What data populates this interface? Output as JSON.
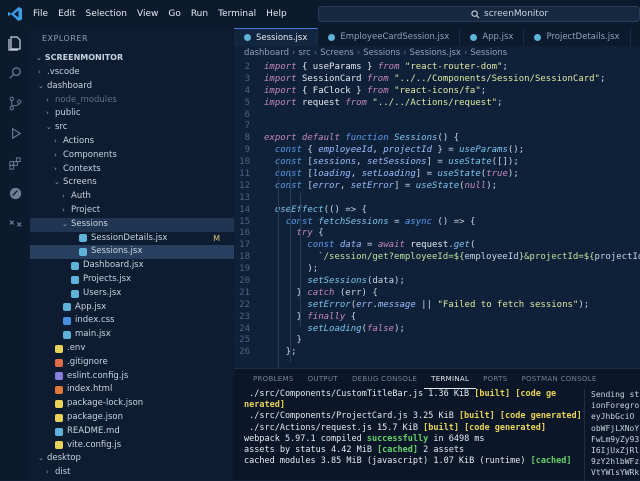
{
  "menu": [
    "File",
    "Edit",
    "Selection",
    "View",
    "Go",
    "Run",
    "Terminal",
    "Help"
  ],
  "command_center": "screenMonitor",
  "explorer": {
    "title": "EXPLORER",
    "root": "SCREENMONITOR",
    "items": [
      {
        "label": ".vscode",
        "indent": 0,
        "type": "folder-closed",
        "color": "#5f7fa8"
      },
      {
        "label": "dashboard",
        "indent": 0,
        "type": "folder-open",
        "color": "#5f7fa8"
      },
      {
        "label": "node_modules",
        "indent": 1,
        "type": "folder-closed",
        "color": "#5f7fa8",
        "dim": true
      },
      {
        "label": "public",
        "indent": 1,
        "type": "folder-closed",
        "color": "#5f7fa8"
      },
      {
        "label": "src",
        "indent": 1,
        "type": "folder-open",
        "color": "#5f7fa8"
      },
      {
        "label": "Actions",
        "indent": 2,
        "type": "folder-closed",
        "color": "#5f7fa8"
      },
      {
        "label": "Components",
        "indent": 2,
        "type": "folder-closed",
        "color": "#5f7fa8"
      },
      {
        "label": "Contexts",
        "indent": 2,
        "type": "folder-closed",
        "color": "#5f7fa8"
      },
      {
        "label": "Screens",
        "indent": 2,
        "type": "folder-open",
        "color": "#5f7fa8"
      },
      {
        "label": "Auth",
        "indent": 3,
        "type": "folder-closed",
        "color": "#5f7fa8"
      },
      {
        "label": "Project",
        "indent": 3,
        "type": "folder-closed",
        "color": "#5f7fa8"
      },
      {
        "label": "Sessions",
        "indent": 3,
        "type": "folder-open",
        "color": "#5f7fa8",
        "selected": true
      },
      {
        "label": "SessionDetails.jsx",
        "indent": 4,
        "type": "file",
        "color": "#5fb3d9",
        "badge": "M"
      },
      {
        "label": "Sessions.jsx",
        "indent": 4,
        "type": "file",
        "color": "#5fb3d9",
        "active": true
      },
      {
        "label": "Dashboard.jsx",
        "indent": 3,
        "type": "file",
        "color": "#5fb3d9"
      },
      {
        "label": "Projects.jsx",
        "indent": 3,
        "type": "file",
        "color": "#5fb3d9"
      },
      {
        "label": "Users.jsx",
        "indent": 3,
        "type": "file",
        "color": "#5fb3d9"
      },
      {
        "label": "App.jsx",
        "indent": 2,
        "type": "file",
        "color": "#5fb3d9"
      },
      {
        "label": "index.css",
        "indent": 2,
        "type": "file",
        "color": "#4a90e2"
      },
      {
        "label": "main.jsx",
        "indent": 2,
        "type": "file",
        "color": "#5fb3d9"
      },
      {
        "label": ".env",
        "indent": 1,
        "type": "file",
        "color": "#e8d25a"
      },
      {
        "label": ".gitignore",
        "indent": 1,
        "type": "file",
        "color": "#e06c4a"
      },
      {
        "label": "eslint.config.js",
        "indent": 1,
        "type": "file",
        "color": "#8a7fd8"
      },
      {
        "label": "index.html",
        "indent": 1,
        "type": "file",
        "color": "#e0793a"
      },
      {
        "label": "package-lock.json",
        "indent": 1,
        "type": "file",
        "color": "#e8d25a"
      },
      {
        "label": "package.json",
        "indent": 1,
        "type": "file",
        "color": "#e8d25a"
      },
      {
        "label": "README.md",
        "indent": 1,
        "type": "file",
        "color": "#5fb3d9"
      },
      {
        "label": "vite.config.js",
        "indent": 1,
        "type": "file",
        "color": "#e8d25a"
      },
      {
        "label": "desktop",
        "indent": 0,
        "type": "folder-open",
        "color": "#5f7fa8"
      },
      {
        "label": "dist",
        "indent": 1,
        "type": "folder-closed",
        "color": "#5f7fa8"
      }
    ]
  },
  "tabs": [
    {
      "label": "Sessions.jsx",
      "active": true
    },
    {
      "label": "EmployeeCardSession.jsx",
      "active": false
    },
    {
      "label": "App.jsx",
      "active": false
    },
    {
      "label": "ProjectDetails.jsx",
      "active": false
    }
  ],
  "breadcrumb": [
    "dashboard",
    "src",
    "Screens",
    "Sessions",
    "Sessions.jsx",
    "Sessions"
  ],
  "code": [
    {
      "n": "2",
      "html": "<span class='kw'>import</span> <span class='var'>{ useParams }</span> <span class='kw'>from</span> <span class='str'>\"react-router-dom\"</span>;"
    },
    {
      "n": "3",
      "html": "<span class='kw'>import</span> <span class='var'>SessionCard</span> <span class='kw'>from</span> <span class='str'>\"../../Components/Session/SessionCard\"</span>;"
    },
    {
      "n": "4",
      "html": "<span class='kw'>import</span> <span class='var'>{ FaClock }</span> <span class='kw'>from</span> <span class='str'>\"react-icons/fa\"</span>;"
    },
    {
      "n": "5",
      "html": "<span class='kw'>import</span> <span class='var'>request</span> <span class='kw'>from</span> <span class='str'>\"../../Actions/request\"</span>;"
    },
    {
      "n": "6",
      "html": ""
    },
    {
      "n": "7",
      "html": ""
    },
    {
      "n": "8",
      "html": "<span class='kw'>export default</span> <span class='kw2'>function</span> <span class='fn'>Sessions</span>() {"
    },
    {
      "n": "9",
      "html": "  <span class='kw2'>const</span> { <span class='param'>employeeId</span>, <span class='param'>projectId</span> } = <span class='fn'>useParams</span>();"
    },
    {
      "n": "10",
      "html": "  <span class='kw2'>const</span> [<span class='param'>sessions</span>, <span class='param'>setSessions</span>] = <span class='fn'>useState</span>([]);"
    },
    {
      "n": "11",
      "html": "  <span class='kw2'>const</span> [<span class='param'>loading</span>, <span class='param'>setLoading</span>] = <span class='fn'>useState</span>(<span class='kw'>true</span>);"
    },
    {
      "n": "12",
      "html": "  <span class='kw2'>const</span> [<span class='param'>error</span>, <span class='param'>setError</span>] = <span class='fn'>useState</span>(<span class='kw'>null</span>);"
    },
    {
      "n": "13",
      "html": ""
    },
    {
      "n": "14",
      "html": "  <span class='fn'>useEffect</span>(() => {"
    },
    {
      "n": "15",
      "html": "    <span class='kw2'>const</span> <span class='fn'>fetchSessions</span> = <span class='kw2'>async</span> () => {"
    },
    {
      "n": "16",
      "html": "      <span class='kw'>try</span> {"
    },
    {
      "n": "17",
      "html": "        <span class='kw2'>const</span> <span class='param'>data</span> = <span class='kw'>await</span> <span class='var'>request</span>.<span class='fn'>get</span>("
    },
    {
      "n": "18",
      "html": "          <span class='tpl'>`/session/get?employeeId=${</span>employeeId<span class='tpl'>}&amp;projectId=${</span>projectId<span class='tpl'>}`</span>"
    },
    {
      "n": "19",
      "html": "        );"
    },
    {
      "n": "20",
      "html": "        <span class='fn'>setSessions</span>(data);"
    },
    {
      "n": "21",
      "html": "      } <span class='kw'>catch</span> (err) {"
    },
    {
      "n": "22",
      "html": "        <span class='fn'>setError</span>(<span class='param'>err</span>.<span class='param'>message</span> || <span class='str'>\"Failed to fetch sessions\"</span>);"
    },
    {
      "n": "23",
      "html": "      } <span class='kw'>finally</span> {"
    },
    {
      "n": "24",
      "html": "        <span class='fn'>setLoading</span>(<span class='kw'>false</span>);"
    },
    {
      "n": "25",
      "html": "      }"
    },
    {
      "n": "26",
      "html": "    };"
    }
  ],
  "panel_tabs": [
    {
      "label": "PROBLEMS",
      "active": false
    },
    {
      "label": "OUTPUT",
      "active": false
    },
    {
      "label": "DEBUG CONSOLE",
      "active": false
    },
    {
      "label": "TERMINAL",
      "active": true
    },
    {
      "label": "PORTS",
      "active": false
    },
    {
      "label": "POSTMAN CONSOLE",
      "active": false
    }
  ],
  "terminal": [
    "<span> ./src/Components/CustomTitleBar.js 1.36 KiB </span><span class='y'>[built] [code ge</span>",
    "<span class='y'>nerated]</span>",
    "<span> ./src/Components/ProjectCard.js 3.25 KiB </span><span class='y'>[built] [code generated]</span>",
    "<span> ./src/Actions/request.js 15.7 KiB </span><span class='y'>[built] [code generated]</span>",
    "<span>webpack 5.97.1 compiled </span><span class='g'>successfully</span><span> in 6498 ms</span>",
    "<span>assets by status 4.42 MiB </span><span class='g'>[cached]</span><span> 2 assets</span>",
    "<span>cached modules 3.85 MiB (javascript) 1.07 KiB (runtime) </span><span class='g'>[cached]</span>"
  ],
  "terminal_side": [
    "Sending st",
    "ionForegro",
    "  eyJhbGciO",
    "obWFjLXNoY",
    "FwLm9yZy93",
    "I6IjUxZjRl",
    "9zY2hlbWFz",
    "VtYWlsYWRk"
  ]
}
